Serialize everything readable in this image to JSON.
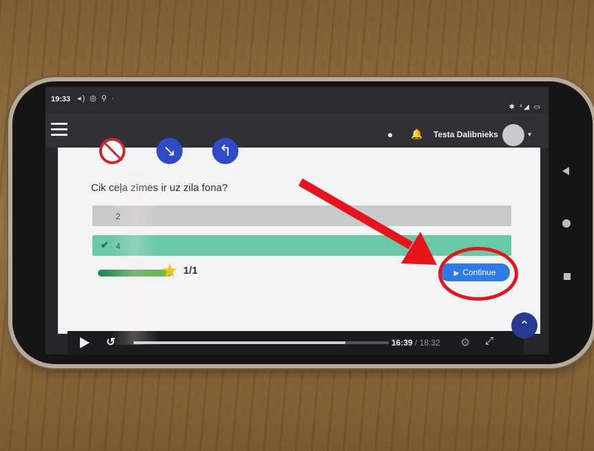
{
  "status_bar": {
    "time": "19:33",
    "icons": "◂) ◎ ⚲ ·",
    "right_icons": "✱ ⁴◢ ▭"
  },
  "app_bar": {
    "user_name": "Testa Dalibnieks"
  },
  "quiz": {
    "question": "Cik ceļa zīmes ir uz zila fona?",
    "answers": [
      {
        "label": "2",
        "correct": false
      },
      {
        "label": "4",
        "correct": true
      }
    ],
    "progress": {
      "fraction": 1.0,
      "label": "1/1"
    },
    "continue_label": "Continue"
  },
  "video_bar": {
    "current_time": "16:39",
    "separator": " / ",
    "total_time": "18:32",
    "progress_fraction": 0.83
  },
  "glyphs": {
    "chat": "●",
    "bell": "🔔",
    "caret": "▾",
    "check": "✔",
    "star": "★",
    "play_small": "▶",
    "replay": "↺",
    "settings": "⚙",
    "fullscreen": "⤢",
    "scroll_top": "⌃",
    "sign_arrow_1": "↘",
    "sign_arrow_2": "↰"
  },
  "colors": {
    "accent": "#2f7be6",
    "correct": "#69c9a7",
    "annotation": "#e8141c",
    "sign_blue": "#2f49c9",
    "sign_red": "#d3232c"
  }
}
